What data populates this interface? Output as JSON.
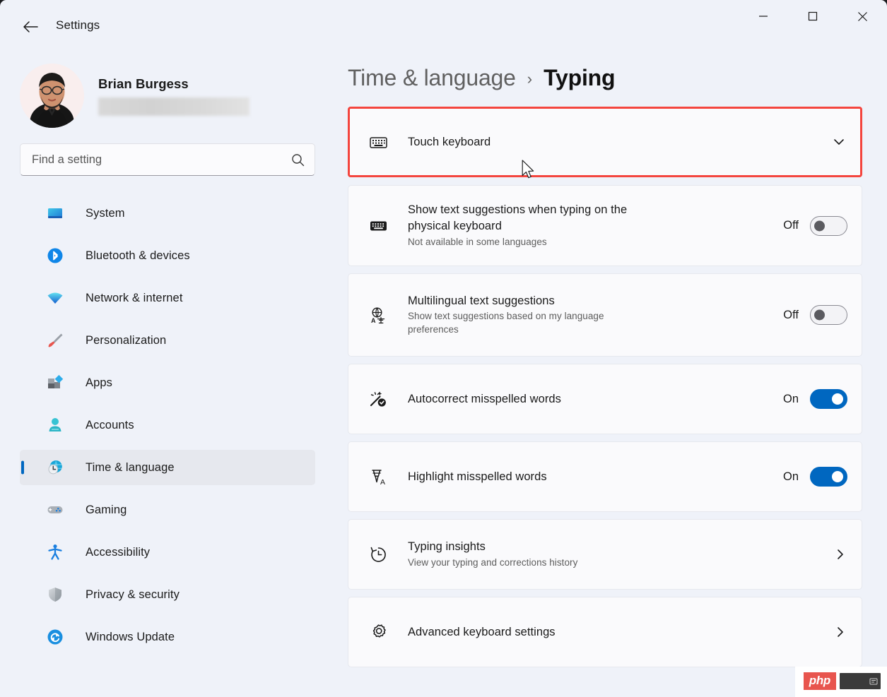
{
  "window": {
    "app_title": "Settings",
    "back_icon": "back-arrow-icon",
    "controls": {
      "minimize": "minimize-icon",
      "maximize": "maximize-icon",
      "close": "close-icon"
    }
  },
  "accent_color": "#0067C0",
  "highlight_color": "#F4453E",
  "sidebar": {
    "account": {
      "name": "Brian Burgess",
      "email_redacted": true
    },
    "search": {
      "placeholder": "Find a setting",
      "value": "",
      "icon": "search-icon"
    },
    "items": [
      {
        "label": "System",
        "icon": "monitor-icon",
        "selected": false
      },
      {
        "label": "Bluetooth & devices",
        "icon": "bluetooth-icon",
        "selected": false
      },
      {
        "label": "Network & internet",
        "icon": "wifi-icon",
        "selected": false
      },
      {
        "label": "Personalization",
        "icon": "paintbrush-icon",
        "selected": false
      },
      {
        "label": "Apps",
        "icon": "apps-icon",
        "selected": false
      },
      {
        "label": "Accounts",
        "icon": "person-icon",
        "selected": false
      },
      {
        "label": "Time & language",
        "icon": "clock-globe-icon",
        "selected": true
      },
      {
        "label": "Gaming",
        "icon": "gamepad-icon",
        "selected": false
      },
      {
        "label": "Accessibility",
        "icon": "accessibility-icon",
        "selected": false
      },
      {
        "label": "Privacy & security",
        "icon": "shield-icon",
        "selected": false
      },
      {
        "label": "Windows Update",
        "icon": "update-icon",
        "selected": false
      }
    ]
  },
  "main": {
    "breadcrumb": {
      "parent": "Time & language",
      "separator": "›",
      "current": "Typing"
    },
    "cards": [
      {
        "title": "Touch keyboard",
        "subtitle": "",
        "icon": "touch-keyboard-icon",
        "control": "chevron-down",
        "highlighted": true
      },
      {
        "title": "Show text suggestions when typing on the physical keyboard",
        "subtitle": "Not available in some languages",
        "icon": "physical-keyboard-icon",
        "control": "toggle",
        "toggle_state": "Off",
        "highlighted": false
      },
      {
        "title": "Multilingual text suggestions",
        "subtitle": "Show text suggestions based on my language preferences",
        "icon": "translate-globe-icon",
        "control": "toggle",
        "toggle_state": "Off",
        "highlighted": false
      },
      {
        "title": "Autocorrect misspelled words",
        "subtitle": "",
        "icon": "magic-wand-check-icon",
        "control": "toggle",
        "toggle_state": "On",
        "highlighted": false
      },
      {
        "title": "Highlight misspelled words",
        "subtitle": "",
        "icon": "highlighter-a-icon",
        "control": "toggle",
        "toggle_state": "On",
        "highlighted": false
      },
      {
        "title": "Typing insights",
        "subtitle": "View your typing and corrections history",
        "icon": "history-clock-icon",
        "control": "chevron-right",
        "highlighted": false
      },
      {
        "title": "Advanced keyboard settings",
        "subtitle": "",
        "icon": "gear-icon",
        "control": "chevron-right",
        "highlighted": false
      }
    ]
  },
  "watermark": {
    "text": "php"
  }
}
